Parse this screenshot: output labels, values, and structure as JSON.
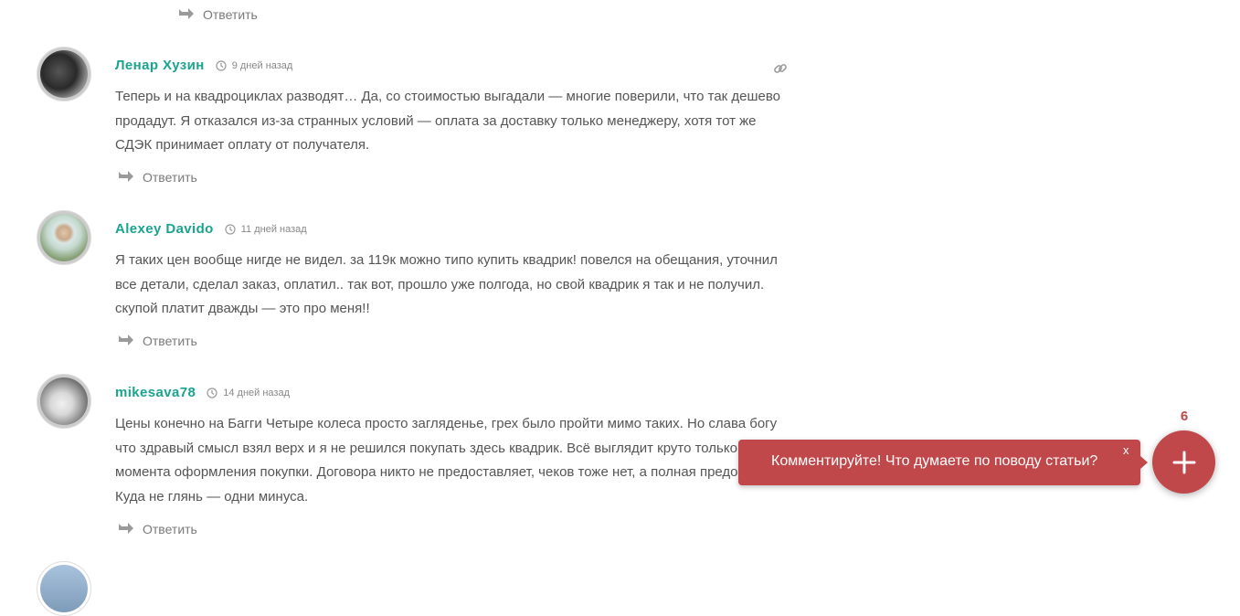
{
  "top_reply": {
    "label": "Ответить"
  },
  "comments": [
    {
      "author": "Ленар Хузин",
      "time": "9 дней назад",
      "text": "Теперь и на квадроциклах разводят… Да, со стоимостью выгадали — многие поверили, что так дешево продадут. Я отказался из-за странных условий — оплата за доставку только менеджеру, хотя тот же СДЭК принимает оплату от получателя.",
      "reply_label": "Ответить"
    },
    {
      "author": "Alexey Davido",
      "time": "11 дней назад",
      "text": "Я таких цен вообще нигде не видел. за 119к можно типо купить квадрик! повелся на обещания, уточнил все детали, сделал заказ, оплатил.. так вот, прошло уже полгода, но свой квадрик я так и не получил. скупой платит дважды — это про меня!!",
      "reply_label": "Ответить"
    },
    {
      "author": "mikesava78",
      "time": "14 дней назад",
      "text": "Цены конечно на Багги Четыре колеса просто загляденье, грех было пройти мимо таких. Но слава богу что здравый смысл взял верх и я не решился покупать здесь квадрик. Всё выглядит круто только до момента оформления покупки. Договора никто не предоставляет, чеков тоже нет, а полная предоплата. Куда не глянь — одни минуса.",
      "reply_label": "Ответить"
    }
  ],
  "prompt": {
    "text": "Комментируйте! Что думаете по поводу статьи?",
    "close": "x",
    "count": "6"
  },
  "colors": {
    "accent": "#1aa38f",
    "prompt": "#c0484a"
  },
  "icons": [
    "reply-arrow-icon",
    "clock-icon",
    "link-icon",
    "plus-icon"
  ]
}
